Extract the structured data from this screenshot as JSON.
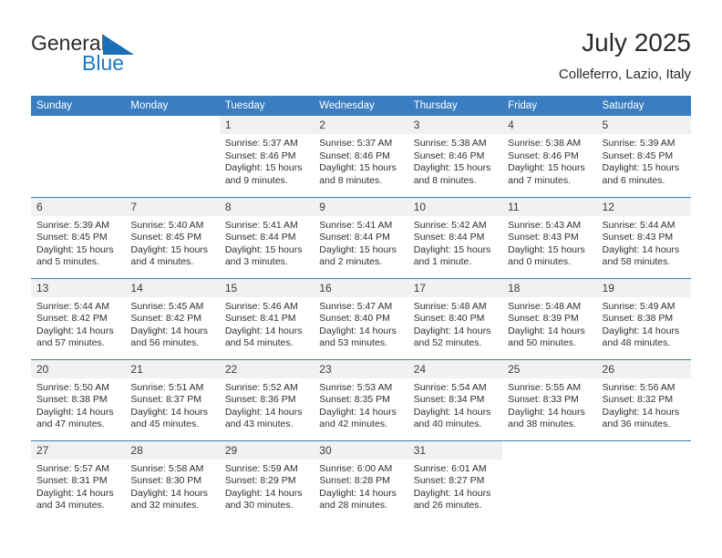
{
  "brand": {
    "name_part1": "General",
    "name_part2": "Blue",
    "triangle_color": "#1a6fb5",
    "accent_color": "#1a7ac4"
  },
  "header": {
    "title": "July 2025",
    "subtitle": "Colleferro, Lazio, Italy"
  },
  "theme": {
    "header_blue": "#3a7dc0",
    "daynum_bg": "#f1f1f1",
    "text": "#2f2f2f"
  },
  "calendar": {
    "weekday_headers": [
      "Sunday",
      "Monday",
      "Tuesday",
      "Wednesday",
      "Thursday",
      "Friday",
      "Saturday"
    ],
    "weeks": [
      [
        {
          "day": "",
          "blank": true
        },
        {
          "day": "",
          "blank": true
        },
        {
          "day": "1",
          "sunrise": "Sunrise: 5:37 AM",
          "sunset": "Sunset: 8:46 PM",
          "daylight": "Daylight: 15 hours and 9 minutes."
        },
        {
          "day": "2",
          "sunrise": "Sunrise: 5:37 AM",
          "sunset": "Sunset: 8:46 PM",
          "daylight": "Daylight: 15 hours and 8 minutes."
        },
        {
          "day": "3",
          "sunrise": "Sunrise: 5:38 AM",
          "sunset": "Sunset: 8:46 PM",
          "daylight": "Daylight: 15 hours and 8 minutes."
        },
        {
          "day": "4",
          "sunrise": "Sunrise: 5:38 AM",
          "sunset": "Sunset: 8:46 PM",
          "daylight": "Daylight: 15 hours and 7 minutes."
        },
        {
          "day": "5",
          "sunrise": "Sunrise: 5:39 AM",
          "sunset": "Sunset: 8:45 PM",
          "daylight": "Daylight: 15 hours and 6 minutes."
        }
      ],
      [
        {
          "day": "6",
          "sunrise": "Sunrise: 5:39 AM",
          "sunset": "Sunset: 8:45 PM",
          "daylight": "Daylight: 15 hours and 5 minutes."
        },
        {
          "day": "7",
          "sunrise": "Sunrise: 5:40 AM",
          "sunset": "Sunset: 8:45 PM",
          "daylight": "Daylight: 15 hours and 4 minutes."
        },
        {
          "day": "8",
          "sunrise": "Sunrise: 5:41 AM",
          "sunset": "Sunset: 8:44 PM",
          "daylight": "Daylight: 15 hours and 3 minutes."
        },
        {
          "day": "9",
          "sunrise": "Sunrise: 5:41 AM",
          "sunset": "Sunset: 8:44 PM",
          "daylight": "Daylight: 15 hours and 2 minutes."
        },
        {
          "day": "10",
          "sunrise": "Sunrise: 5:42 AM",
          "sunset": "Sunset: 8:44 PM",
          "daylight": "Daylight: 15 hours and 1 minute."
        },
        {
          "day": "11",
          "sunrise": "Sunrise: 5:43 AM",
          "sunset": "Sunset: 8:43 PM",
          "daylight": "Daylight: 15 hours and 0 minutes."
        },
        {
          "day": "12",
          "sunrise": "Sunrise: 5:44 AM",
          "sunset": "Sunset: 8:43 PM",
          "daylight": "Daylight: 14 hours and 58 minutes."
        }
      ],
      [
        {
          "day": "13",
          "sunrise": "Sunrise: 5:44 AM",
          "sunset": "Sunset: 8:42 PM",
          "daylight": "Daylight: 14 hours and 57 minutes."
        },
        {
          "day": "14",
          "sunrise": "Sunrise: 5:45 AM",
          "sunset": "Sunset: 8:42 PM",
          "daylight": "Daylight: 14 hours and 56 minutes."
        },
        {
          "day": "15",
          "sunrise": "Sunrise: 5:46 AM",
          "sunset": "Sunset: 8:41 PM",
          "daylight": "Daylight: 14 hours and 54 minutes."
        },
        {
          "day": "16",
          "sunrise": "Sunrise: 5:47 AM",
          "sunset": "Sunset: 8:40 PM",
          "daylight": "Daylight: 14 hours and 53 minutes."
        },
        {
          "day": "17",
          "sunrise": "Sunrise: 5:48 AM",
          "sunset": "Sunset: 8:40 PM",
          "daylight": "Daylight: 14 hours and 52 minutes."
        },
        {
          "day": "18",
          "sunrise": "Sunrise: 5:48 AM",
          "sunset": "Sunset: 8:39 PM",
          "daylight": "Daylight: 14 hours and 50 minutes."
        },
        {
          "day": "19",
          "sunrise": "Sunrise: 5:49 AM",
          "sunset": "Sunset: 8:38 PM",
          "daylight": "Daylight: 14 hours and 48 minutes."
        }
      ],
      [
        {
          "day": "20",
          "sunrise": "Sunrise: 5:50 AM",
          "sunset": "Sunset: 8:38 PM",
          "daylight": "Daylight: 14 hours and 47 minutes."
        },
        {
          "day": "21",
          "sunrise": "Sunrise: 5:51 AM",
          "sunset": "Sunset: 8:37 PM",
          "daylight": "Daylight: 14 hours and 45 minutes."
        },
        {
          "day": "22",
          "sunrise": "Sunrise: 5:52 AM",
          "sunset": "Sunset: 8:36 PM",
          "daylight": "Daylight: 14 hours and 43 minutes."
        },
        {
          "day": "23",
          "sunrise": "Sunrise: 5:53 AM",
          "sunset": "Sunset: 8:35 PM",
          "daylight": "Daylight: 14 hours and 42 minutes."
        },
        {
          "day": "24",
          "sunrise": "Sunrise: 5:54 AM",
          "sunset": "Sunset: 8:34 PM",
          "daylight": "Daylight: 14 hours and 40 minutes."
        },
        {
          "day": "25",
          "sunrise": "Sunrise: 5:55 AM",
          "sunset": "Sunset: 8:33 PM",
          "daylight": "Daylight: 14 hours and 38 minutes."
        },
        {
          "day": "26",
          "sunrise": "Sunrise: 5:56 AM",
          "sunset": "Sunset: 8:32 PM",
          "daylight": "Daylight: 14 hours and 36 minutes."
        }
      ],
      [
        {
          "day": "27",
          "sunrise": "Sunrise: 5:57 AM",
          "sunset": "Sunset: 8:31 PM",
          "daylight": "Daylight: 14 hours and 34 minutes."
        },
        {
          "day": "28",
          "sunrise": "Sunrise: 5:58 AM",
          "sunset": "Sunset: 8:30 PM",
          "daylight": "Daylight: 14 hours and 32 minutes."
        },
        {
          "day": "29",
          "sunrise": "Sunrise: 5:59 AM",
          "sunset": "Sunset: 8:29 PM",
          "daylight": "Daylight: 14 hours and 30 minutes."
        },
        {
          "day": "30",
          "sunrise": "Sunrise: 6:00 AM",
          "sunset": "Sunset: 8:28 PM",
          "daylight": "Daylight: 14 hours and 28 minutes."
        },
        {
          "day": "31",
          "sunrise": "Sunrise: 6:01 AM",
          "sunset": "Sunset: 8:27 PM",
          "daylight": "Daylight: 14 hours and 26 minutes."
        },
        {
          "day": "",
          "blank": true
        },
        {
          "day": "",
          "blank": true
        }
      ]
    ]
  }
}
